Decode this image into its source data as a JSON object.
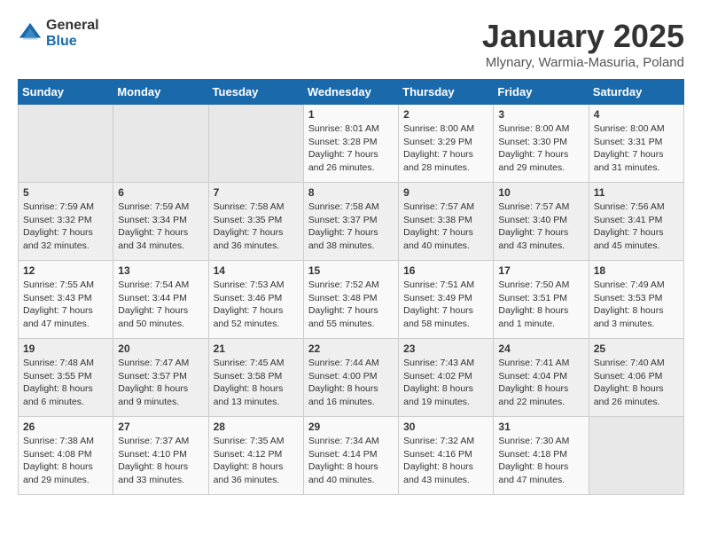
{
  "header": {
    "logo_general": "General",
    "logo_blue": "Blue",
    "month_title": "January 2025",
    "location": "Mlynary, Warmia-Masuria, Poland"
  },
  "days_of_week": [
    "Sunday",
    "Monday",
    "Tuesday",
    "Wednesday",
    "Thursday",
    "Friday",
    "Saturday"
  ],
  "weeks": [
    [
      {
        "day": "",
        "content": ""
      },
      {
        "day": "",
        "content": ""
      },
      {
        "day": "",
        "content": ""
      },
      {
        "day": "1",
        "content": "Sunrise: 8:01 AM\nSunset: 3:28 PM\nDaylight: 7 hours\nand 26 minutes."
      },
      {
        "day": "2",
        "content": "Sunrise: 8:00 AM\nSunset: 3:29 PM\nDaylight: 7 hours\nand 28 minutes."
      },
      {
        "day": "3",
        "content": "Sunrise: 8:00 AM\nSunset: 3:30 PM\nDaylight: 7 hours\nand 29 minutes."
      },
      {
        "day": "4",
        "content": "Sunrise: 8:00 AM\nSunset: 3:31 PM\nDaylight: 7 hours\nand 31 minutes."
      }
    ],
    [
      {
        "day": "5",
        "content": "Sunrise: 7:59 AM\nSunset: 3:32 PM\nDaylight: 7 hours\nand 32 minutes."
      },
      {
        "day": "6",
        "content": "Sunrise: 7:59 AM\nSunset: 3:34 PM\nDaylight: 7 hours\nand 34 minutes."
      },
      {
        "day": "7",
        "content": "Sunrise: 7:58 AM\nSunset: 3:35 PM\nDaylight: 7 hours\nand 36 minutes."
      },
      {
        "day": "8",
        "content": "Sunrise: 7:58 AM\nSunset: 3:37 PM\nDaylight: 7 hours\nand 38 minutes."
      },
      {
        "day": "9",
        "content": "Sunrise: 7:57 AM\nSunset: 3:38 PM\nDaylight: 7 hours\nand 40 minutes."
      },
      {
        "day": "10",
        "content": "Sunrise: 7:57 AM\nSunset: 3:40 PM\nDaylight: 7 hours\nand 43 minutes."
      },
      {
        "day": "11",
        "content": "Sunrise: 7:56 AM\nSunset: 3:41 PM\nDaylight: 7 hours\nand 45 minutes."
      }
    ],
    [
      {
        "day": "12",
        "content": "Sunrise: 7:55 AM\nSunset: 3:43 PM\nDaylight: 7 hours\nand 47 minutes."
      },
      {
        "day": "13",
        "content": "Sunrise: 7:54 AM\nSunset: 3:44 PM\nDaylight: 7 hours\nand 50 minutes."
      },
      {
        "day": "14",
        "content": "Sunrise: 7:53 AM\nSunset: 3:46 PM\nDaylight: 7 hours\nand 52 minutes."
      },
      {
        "day": "15",
        "content": "Sunrise: 7:52 AM\nSunset: 3:48 PM\nDaylight: 7 hours\nand 55 minutes."
      },
      {
        "day": "16",
        "content": "Sunrise: 7:51 AM\nSunset: 3:49 PM\nDaylight: 7 hours\nand 58 minutes."
      },
      {
        "day": "17",
        "content": "Sunrise: 7:50 AM\nSunset: 3:51 PM\nDaylight: 8 hours\nand 1 minute."
      },
      {
        "day": "18",
        "content": "Sunrise: 7:49 AM\nSunset: 3:53 PM\nDaylight: 8 hours\nand 3 minutes."
      }
    ],
    [
      {
        "day": "19",
        "content": "Sunrise: 7:48 AM\nSunset: 3:55 PM\nDaylight: 8 hours\nand 6 minutes."
      },
      {
        "day": "20",
        "content": "Sunrise: 7:47 AM\nSunset: 3:57 PM\nDaylight: 8 hours\nand 9 minutes."
      },
      {
        "day": "21",
        "content": "Sunrise: 7:45 AM\nSunset: 3:58 PM\nDaylight: 8 hours\nand 13 minutes."
      },
      {
        "day": "22",
        "content": "Sunrise: 7:44 AM\nSunset: 4:00 PM\nDaylight: 8 hours\nand 16 minutes."
      },
      {
        "day": "23",
        "content": "Sunrise: 7:43 AM\nSunset: 4:02 PM\nDaylight: 8 hours\nand 19 minutes."
      },
      {
        "day": "24",
        "content": "Sunrise: 7:41 AM\nSunset: 4:04 PM\nDaylight: 8 hours\nand 22 minutes."
      },
      {
        "day": "25",
        "content": "Sunrise: 7:40 AM\nSunset: 4:06 PM\nDaylight: 8 hours\nand 26 minutes."
      }
    ],
    [
      {
        "day": "26",
        "content": "Sunrise: 7:38 AM\nSunset: 4:08 PM\nDaylight: 8 hours\nand 29 minutes."
      },
      {
        "day": "27",
        "content": "Sunrise: 7:37 AM\nSunset: 4:10 PM\nDaylight: 8 hours\nand 33 minutes."
      },
      {
        "day": "28",
        "content": "Sunrise: 7:35 AM\nSunset: 4:12 PM\nDaylight: 8 hours\nand 36 minutes."
      },
      {
        "day": "29",
        "content": "Sunrise: 7:34 AM\nSunset: 4:14 PM\nDaylight: 8 hours\nand 40 minutes."
      },
      {
        "day": "30",
        "content": "Sunrise: 7:32 AM\nSunset: 4:16 PM\nDaylight: 8 hours\nand 43 minutes."
      },
      {
        "day": "31",
        "content": "Sunrise: 7:30 AM\nSunset: 4:18 PM\nDaylight: 8 hours\nand 47 minutes."
      },
      {
        "day": "",
        "content": ""
      }
    ]
  ]
}
